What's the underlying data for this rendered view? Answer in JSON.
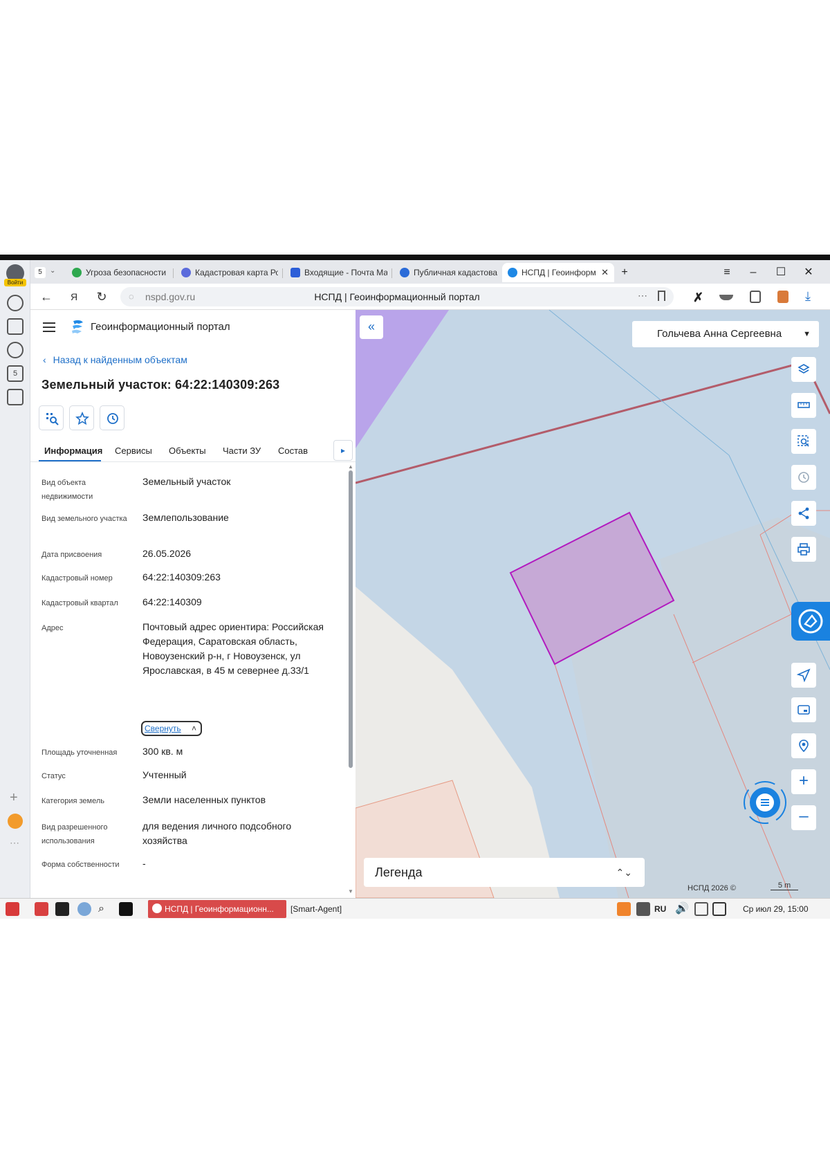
{
  "browser": {
    "login_badge": "Войти",
    "tab_count": "5",
    "tabs": [
      {
        "label": "Угроза безопасности",
        "icon": "shield-check-icon",
        "color": "#2fa84f"
      },
      {
        "label": "Кадастровая карта Ро",
        "icon": "map-icon",
        "color": "#5b6bdc"
      },
      {
        "label": "Входящие - Почта Ма",
        "icon": "mail-icon",
        "color": "#2c5ed8"
      },
      {
        "label": "Публичная кадастова",
        "icon": "shield-icon",
        "color": "#2a6bd8"
      },
      {
        "label": "НСПД | Геоинформ",
        "icon": "nspd-logo-icon",
        "color": "#1e88e5",
        "active": true
      }
    ],
    "url": "nspd.gov.ru",
    "page_title": "НСПД | Геоинформационный портал"
  },
  "panel": {
    "portal_title": "Геоинформационный портал",
    "back_link": "Назад к найденным объектам",
    "object_title": "Земельный участок: 64:22:140309:263",
    "tabs": [
      "Информация",
      "Сервисы",
      "Объекты",
      "Части ЗУ",
      "Состав"
    ],
    "fields": [
      {
        "label": "Вид объекта недвижимости",
        "value": "Земельный участок"
      },
      {
        "label": "Вид земельного участка",
        "value": "Землепользование"
      },
      {
        "label": "Дата присвоения",
        "value": "26.05.2026"
      },
      {
        "label": "Кадастровый номер",
        "value": "64:22:140309:263"
      },
      {
        "label": "Кадастровый квартал",
        "value": "64:22:140309"
      },
      {
        "label": "Адрес",
        "value": "Почтовый адрес ориентира: Российская Федерация, Саратовская область, Новоузенский р-н, г Новоузенск, ул Ярославская, в 45 м севернее д.33/1"
      },
      {
        "label": "Площадь уточненная",
        "value": "300 кв. м"
      },
      {
        "label": "Статус",
        "value": "Учтенный"
      },
      {
        "label": "Категория земель",
        "value": "Земли населенных пунктов"
      },
      {
        "label": "Вид разрешенного использования",
        "value": "для ведения личного подсобного хозяйства"
      },
      {
        "label": "Форма собственности",
        "value": "-"
      }
    ],
    "collapse_label": "Свернуть"
  },
  "map": {
    "user_name": "Гольчева Анна Сергеевна",
    "legend_label": "Легенда",
    "copyright": "НСПД 2026 ©",
    "scale_label": "5 m",
    "colors": {
      "base": "#c4d6e6",
      "parcel_fill": "#c6a9d6",
      "parcel_stroke": "#b21bbf",
      "purple_area": "#b9a4ea",
      "boundary": "#b35c6a"
    }
  },
  "taskbar": {
    "active_window": "НСПД | Геоинформационн...",
    "other_window": "[Smart-Agent]",
    "lang": "RU",
    "clock": "Ср июл 29, 15:00"
  }
}
